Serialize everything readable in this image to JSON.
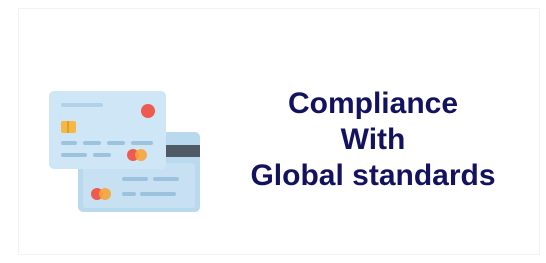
{
  "feature": {
    "heading_lines": [
      "Compliance",
      "With",
      "Global standards"
    ],
    "icon": "credit-cards-icon"
  },
  "colors": {
    "heading": "#13125f",
    "card_back": "#b9d9ef",
    "card_front": "#cfe6f6",
    "card_stripe": "#4f5a66",
    "chip": "#f4b844",
    "mastercard_red": "#ee5a4f",
    "mastercard_orange": "#f7a43a",
    "detail_lines": "#9cc3de"
  }
}
